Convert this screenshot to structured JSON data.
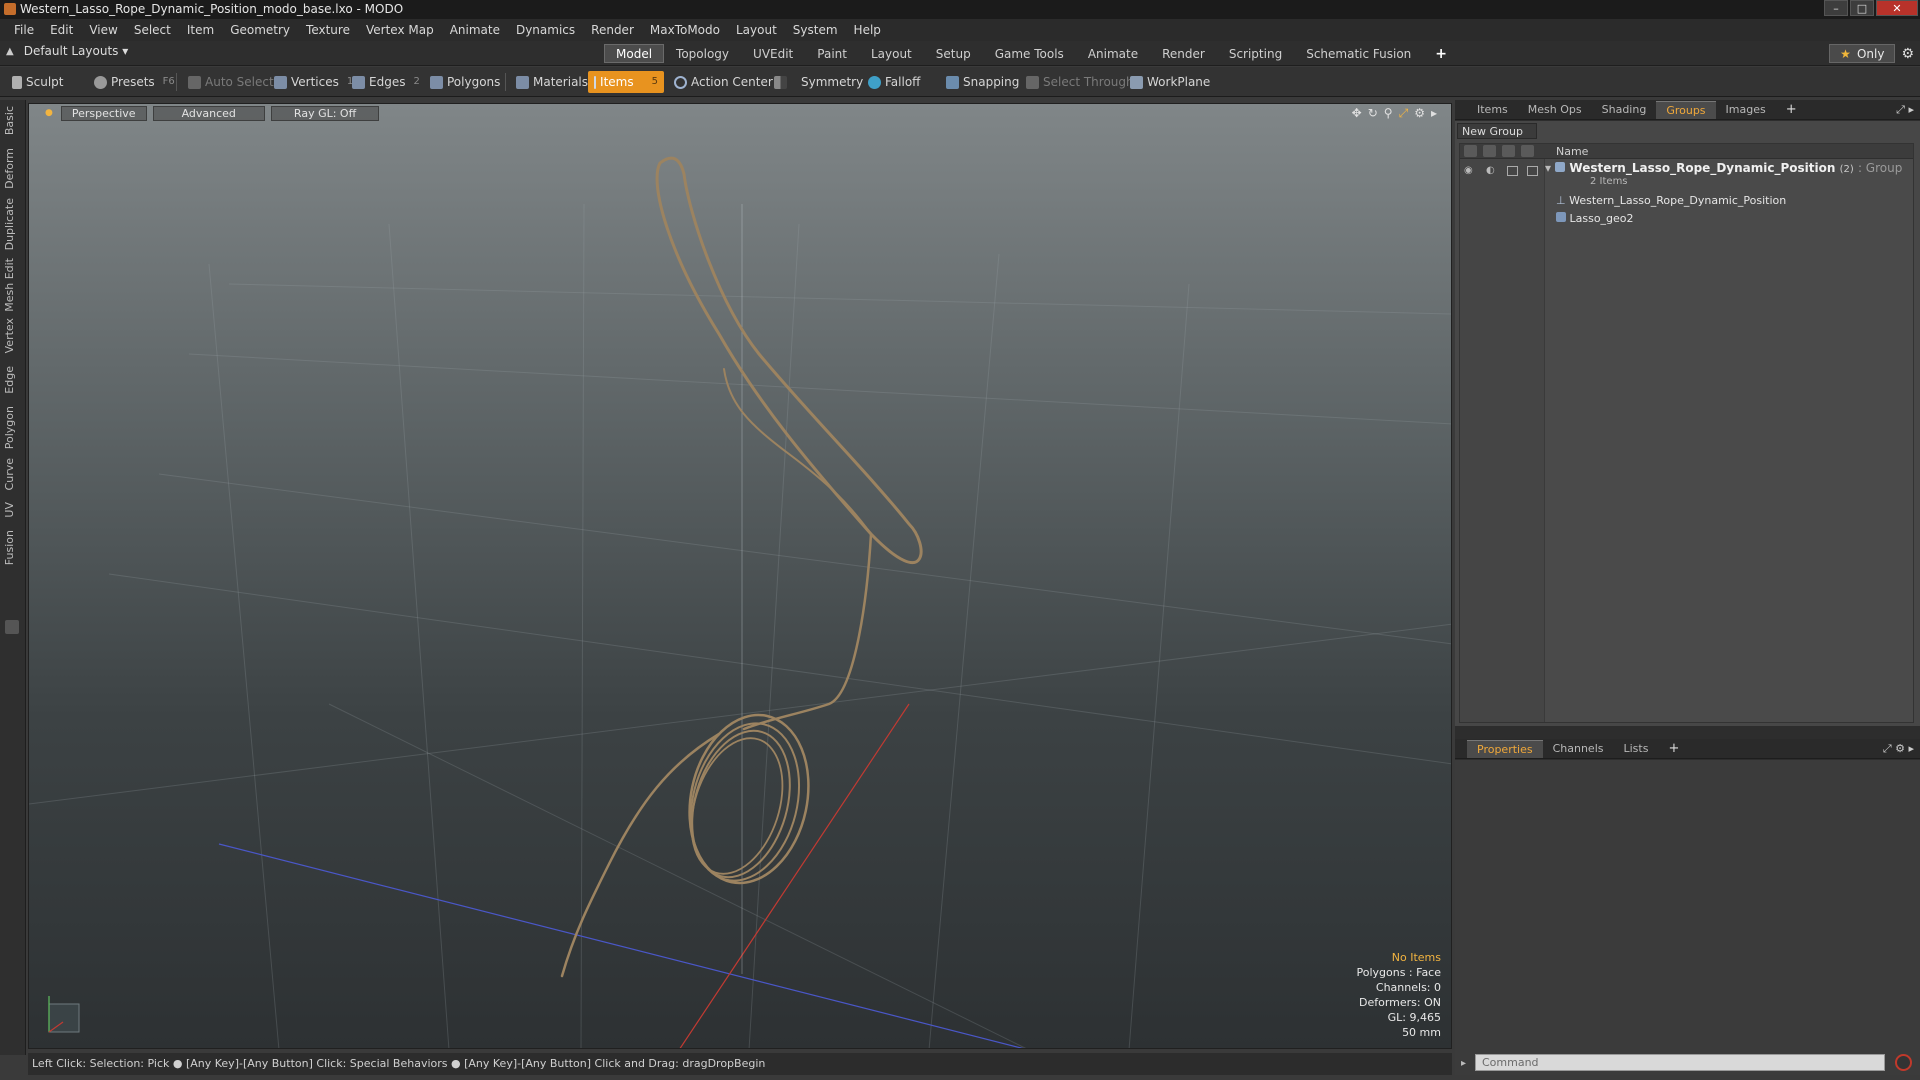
{
  "window": {
    "title": "Western_Lasso_Rope_Dynamic_Position_modo_base.lxo - MODO",
    "controls": [
      "–",
      "□",
      "✕"
    ]
  },
  "menubar": {
    "items": [
      "File",
      "Edit",
      "View",
      "Select",
      "Item",
      "Geometry",
      "Texture",
      "Vertex Map",
      "Animate",
      "Dynamics",
      "Render",
      "MaxToModo",
      "Layout",
      "System",
      "Help"
    ]
  },
  "layoutbar": {
    "layouts_dropdown": "Default Layouts ▾",
    "tabs": [
      "Model",
      "Topology",
      "UVEdit",
      "Paint",
      "Layout",
      "Setup",
      "Game Tools",
      "Animate",
      "Render",
      "Scripting",
      "Schematic Fusion"
    ],
    "active_tab": "Model",
    "plus": "+",
    "only_label": "Only",
    "gear_icon": "gear-icon"
  },
  "toolbar": {
    "sculpt": "Sculpt",
    "presets": "Presets",
    "presets_hotkey": "F6",
    "auto_select": "Auto Select",
    "vertices": "Vertices",
    "vertices_hotkey": "1",
    "edges": "Edges",
    "edges_hotkey": "2",
    "polygons": "Polygons",
    "materials": "Materials",
    "items": "Items",
    "items_hotkey": "5",
    "action_center": "Action Center",
    "symmetry": "Symmetry",
    "falloff": "Falloff",
    "snapping": "Snapping",
    "select_through": "Select Through",
    "workplane": "WorkPlane",
    "accent_color": "#e8931f"
  },
  "lefttabs": [
    "Basic",
    "Deform",
    "Duplicate",
    "Mesh Edit",
    "Vertex",
    "Edge",
    "Polygon",
    "Curve",
    "UV",
    "Fusion"
  ],
  "viewport": {
    "perspective": "Perspective",
    "advanced": "Advanced",
    "raygl": "Ray GL: Off",
    "info": {
      "no_items": "No Items",
      "polygons": "Polygons : Face",
      "channels": "Channels: 0",
      "deformers": "Deformers: ON",
      "gl": "GL: 9,465",
      "scale": "50 mm"
    }
  },
  "statusbar": {
    "text": "Left Click: Selection: Pick ●  [Any Key]-[Any Button] Click: Special Behaviors ●  [Any Key]-[Any Button] Click and Drag: dragDropBegin"
  },
  "rightpanel": {
    "tabs": [
      "Items",
      "Mesh Ops",
      "Shading",
      "Groups",
      "Images"
    ],
    "active_tab": "Groups",
    "new_group": "New Group",
    "name_header": "Name",
    "group_name": "Western_Lasso_Rope_Dynamic_Position",
    "group_count": "(2)",
    "group_type": ": Group",
    "group_items": "2 Items",
    "child1": "Western_Lasso_Rope_Dynamic_Position",
    "child2": "Lasso_geo2",
    "bottom_tabs": [
      "Properties",
      "Channels",
      "Lists"
    ],
    "bottom_active": "Properties",
    "command_placeholder": "Command"
  }
}
